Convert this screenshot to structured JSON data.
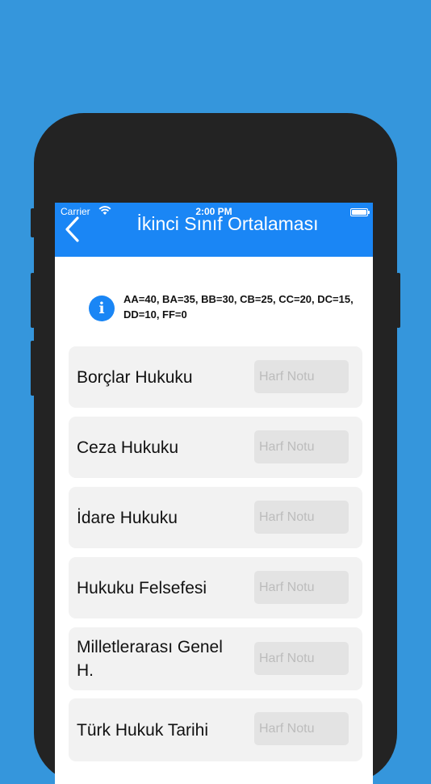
{
  "status_bar": {
    "carrier": "Carrier",
    "time": "2:00 PM"
  },
  "nav": {
    "title": "İkinci Sınıf Ortalaması",
    "back_icon": "chevron-left-icon"
  },
  "info": {
    "icon": "info-icon",
    "icon_glyph": "i",
    "text": "AA=40, BA=35, BB=30, CB=25, CC=20, DC=15, DD=10, FF=0"
  },
  "courses": [
    {
      "name": "Borçlar Hukuku",
      "value": "",
      "placeholder": "Harf Notu"
    },
    {
      "name": "Ceza Hukuku",
      "value": "",
      "placeholder": "Harf Notu"
    },
    {
      "name": "İdare Hukuku",
      "value": "",
      "placeholder": "Harf Notu"
    },
    {
      "name": "Hukuku Felsefesi",
      "value": "",
      "placeholder": "Harf Notu"
    },
    {
      "name": "Milletlerarası Genel H.",
      "value": "",
      "placeholder": "Harf Notu"
    },
    {
      "name": "Türk Hukuk Tarihi",
      "value": "",
      "placeholder": "Harf Notu"
    }
  ],
  "colors": {
    "background": "#3596dc",
    "accent": "#1a86f5",
    "card": "#f2f2f2",
    "field": "#e3e3e3"
  }
}
